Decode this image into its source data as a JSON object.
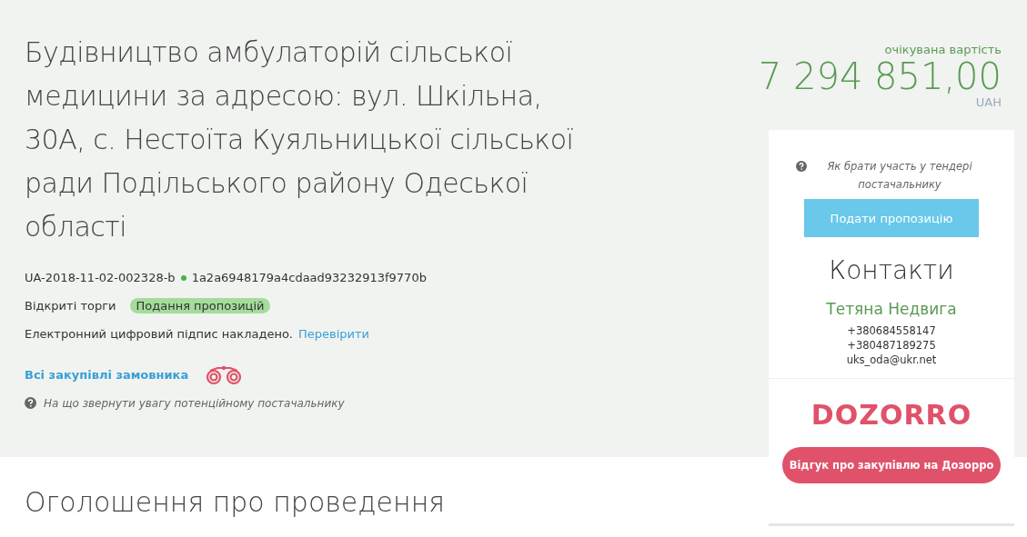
{
  "title": "Будівництво амбулаторій сільської медицини за адресою: вул. Шкільна, 30А, с. Нестоїта Куяльницької сільської ради Подільського району Одеської області",
  "tender_id": "UA-2018-11-02-002328-b",
  "hash": "1a2a6948179a4cdaad93232913f9770b",
  "procedure": "Відкриті торги",
  "status": "Подання пропозицій",
  "signature": {
    "text": "Електронний цифровий підпис накладено.",
    "link": "Перевірити"
  },
  "buyer_link": "Всі закупівлі замовника",
  "hint": "На що звернути увагу потенційному постачальнику",
  "value": {
    "label": "очікувана вартість",
    "amount": "7 294 851,00",
    "currency": "UAH"
  },
  "card": {
    "hint": "Як брати участь у тендері постачальнику",
    "button": "Подати пропозицію",
    "contacts_title": "Контакти",
    "name": "Тетяна Недвига",
    "lines": [
      "+380684558147",
      "+380487189275",
      "uks_oda@ukr.net"
    ],
    "logo": "DOZORRO",
    "review_button": "Відгук про закупівлю на Дозорро"
  },
  "section_title": "Оголошення про проведення"
}
